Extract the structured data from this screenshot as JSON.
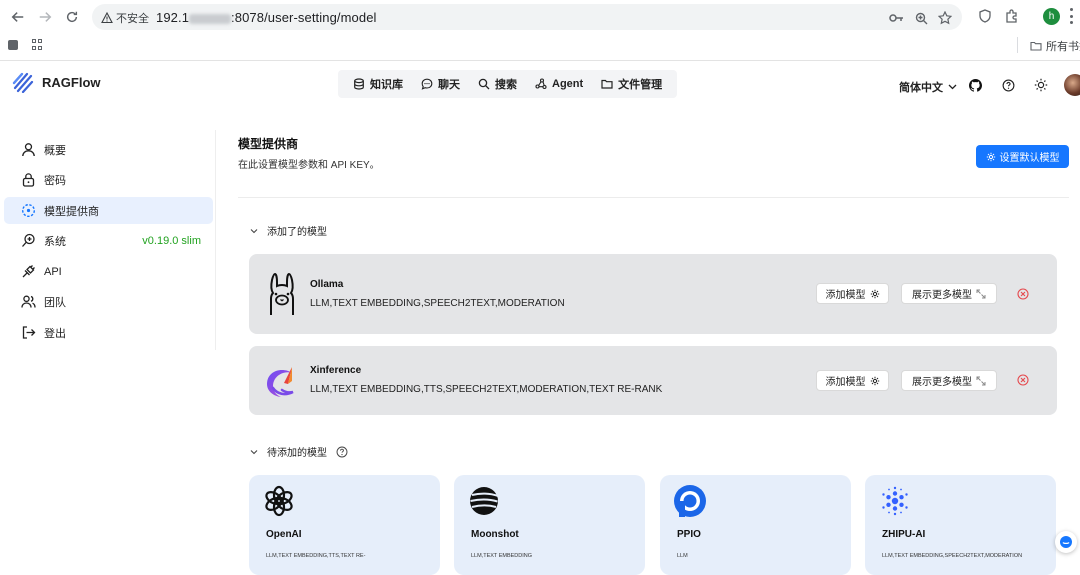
{
  "browser": {
    "security_label": "不安全",
    "url_prefix": "192.1",
    "url_suffix": ":8078/user-setting/model",
    "bookmarks_all": "所有书签",
    "profile_initial": "h"
  },
  "header": {
    "brand": "RAGFlow",
    "nav": [
      {
        "label": "知识库",
        "icon": "database-icon"
      },
      {
        "label": "聊天",
        "icon": "chat-icon"
      },
      {
        "label": "搜索",
        "icon": "search-icon"
      },
      {
        "label": "Agent",
        "icon": "agent-icon"
      },
      {
        "label": "文件管理",
        "icon": "folder-icon"
      }
    ],
    "language": "简体中文"
  },
  "sidebar": {
    "items": [
      {
        "label": "概要",
        "icon": "user-icon"
      },
      {
        "label": "密码",
        "icon": "lock-icon"
      },
      {
        "label": "模型提供商",
        "icon": "model-icon",
        "active": true
      },
      {
        "label": "系统",
        "icon": "system-icon",
        "badge": "v0.19.0 slim"
      },
      {
        "label": "API",
        "icon": "api-icon"
      },
      {
        "label": "团队",
        "icon": "team-icon"
      },
      {
        "label": "登出",
        "icon": "logout-icon"
      }
    ]
  },
  "main": {
    "title": "模型提供商",
    "description": "在此设置模型参数和 API KEY。",
    "default_model_button": "设置默认模型",
    "added_section": "添加了的模型",
    "pending_section": "待添加的模型",
    "added_models": [
      {
        "name": "Ollama",
        "tags": "LLM,TEXT EMBEDDING,SPEECH2TEXT,MODERATION",
        "logo": "llama-icon",
        "add_label": "添加模型",
        "more_label": "展示更多模型"
      },
      {
        "name": "Xinference",
        "tags": "LLM,TEXT EMBEDDING,TTS,SPEECH2TEXT,MODERATION,TEXT RE-RANK",
        "logo": "xinference-icon",
        "add_label": "添加模型",
        "more_label": "展示更多模型"
      }
    ],
    "available_models": [
      {
        "name": "OpenAI",
        "tags": "LLM,TEXT EMBEDDING,TTS,TEXT RE-",
        "logo": "openai-icon"
      },
      {
        "name": "Moonshot",
        "tags": "LLM,TEXT EMBEDDING",
        "logo": "moonshot-icon"
      },
      {
        "name": "PPIO",
        "tags": "LLM",
        "logo": "ppio-icon"
      },
      {
        "name": "ZHIPU-AI",
        "tags": "LLM,TEXT EMBEDDING,SPEECH2TEXT,MODERATION",
        "logo": "zhipu-icon"
      }
    ]
  },
  "colors": {
    "primary": "#1677ff",
    "version_green": "#21a21f",
    "delete_red": "#e5484d",
    "card_bg": "#e6eefa",
    "provider_bg": "#e4e5e7"
  }
}
